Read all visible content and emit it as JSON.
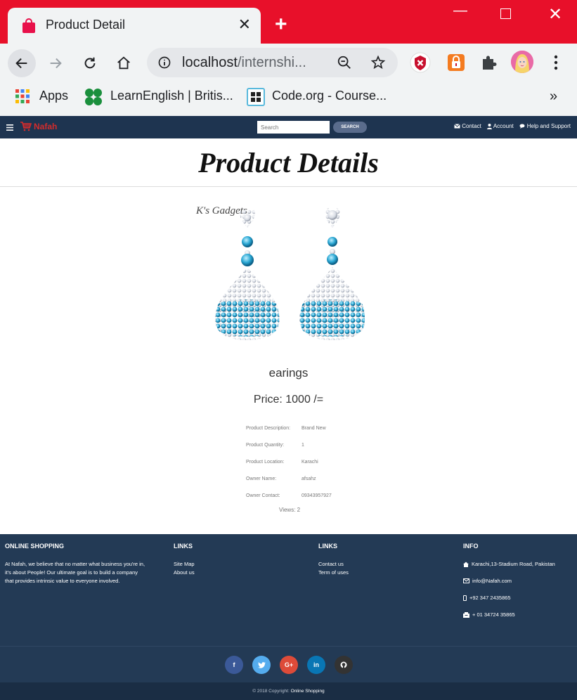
{
  "browser": {
    "tab_title": "Product Detail",
    "url_host": "localhost",
    "url_rest": "/internshi...",
    "bookmarks": [
      {
        "label": "Apps"
      },
      {
        "label": "LearnEnglish | Britis..."
      },
      {
        "label": "Code.org - Course..."
      }
    ],
    "bookmarks_more": "»",
    "accent_color": "#e8102a"
  },
  "site": {
    "logo_text": "Nafah",
    "search_placeholder": "Search",
    "search_button": "SEARCH",
    "nav": {
      "contact": "Contact",
      "account": "Account",
      "help": "Help and Support"
    }
  },
  "page": {
    "title": "Product Details",
    "image_caption": "K's Gadgets",
    "product_name": "earings",
    "price": "Price: 1000 /=",
    "details": [
      {
        "label": "Product Description:",
        "value": "Brand New"
      },
      {
        "label": "Product Quantity:",
        "value": "1"
      },
      {
        "label": "Product Location:",
        "value": "Karachi"
      },
      {
        "label": "Owner Name:",
        "value": "afsahz"
      },
      {
        "label": "Owner Contact:",
        "value": "09343957927"
      }
    ],
    "views": "Views: 2"
  },
  "footer": {
    "col1": {
      "heading": "ONLINE SHOPPING",
      "text": "At Nafah, we believe that no matter what business you're in, it's about People! Our ultimate goal is to build a company that provides intrinsic value to everyone involved."
    },
    "col2": {
      "heading": "LINKS",
      "links": [
        "Site Map",
        "About us"
      ]
    },
    "col3": {
      "heading": "LINKS",
      "links": [
        "Contact us",
        "Term of uses"
      ]
    },
    "col4": {
      "heading": "INFO",
      "address": "Karachi,13-Stadium Road, Pakistan",
      "email": "info@Nafah.com",
      "phone": "+92 347 2435865",
      "fax": "+ 01 34724 35865"
    },
    "socials": [
      {
        "name": "facebook",
        "glyph": "f",
        "color": "#3b5998"
      },
      {
        "name": "twitter",
        "glyph": "t",
        "color": "#55acee"
      },
      {
        "name": "google-plus",
        "glyph": "G+",
        "color": "#dd4b39"
      },
      {
        "name": "linkedin",
        "glyph": "in",
        "color": "#0976b4"
      },
      {
        "name": "github",
        "glyph": "gh",
        "color": "#333333"
      }
    ],
    "copyright_prefix": "© 2018 Copyright:",
    "copyright_link": "Online Shopping"
  }
}
